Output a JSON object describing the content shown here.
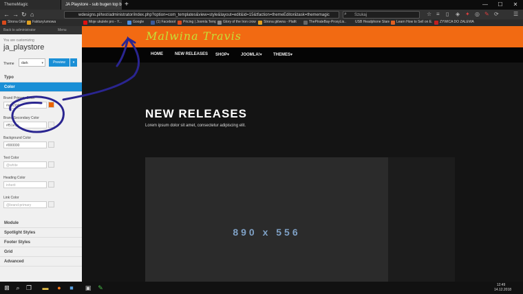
{
  "browser": {
    "tabs": [
      {
        "label": "ThemeMagic"
      },
      {
        "label": "JA Playstore - sub bugen top bar so..."
      }
    ],
    "new_tab": "+",
    "window_controls": {
      "minimize": "—",
      "maximize": "☐",
      "close": "✕"
    },
    "url": "wdesigns.pl/test/administrator/index.php?option=com_templates&view=style&layout=edit&id=15&tfaction=themeEditor&task=thememagic",
    "search_placeholder": "Szukaj",
    "bookmarks": [
      {
        "label": "Strona Główna: UPS",
        "color": "#d94a1c"
      },
      {
        "label": "Faktury/umowa online - ...",
        "color": "#e0a020"
      },
      {
        "label": "Moje ukulele pro - Y...",
        "color": "#e01010"
      },
      {
        "label": "Google",
        "color": "#4a8ee0"
      },
      {
        "label": "(1) Facebook",
        "color": "#3b5998"
      },
      {
        "label": "Pricing | Joomla Temp...",
        "color": "#d94a1c"
      },
      {
        "label": "Glory of the Iron crown ...",
        "color": "#888888"
      },
      {
        "label": "Strona główna - Platfo...",
        "color": "#e0a020"
      },
      {
        "label": "ThePirateBay-ProxyLis...",
        "color": "#666666"
      },
      {
        "label": "USB Headphone Stand...",
        "color": "#2a2a2a"
      },
      {
        "label": "Learn How to Sell on E...",
        "color": "#e06020"
      },
      {
        "label": "ŻYWICA DO ZALEWA...",
        "color": "#c02020"
      }
    ]
  },
  "left_panel": {
    "back_label": "Back to administrator",
    "mod_label": "Menu",
    "customizing_label": "You are customizing",
    "template_name": "ja_playstore",
    "theme_label": "Theme",
    "theme_value": "dark",
    "preview_button": "Preview",
    "sections": {
      "typo": "Typo",
      "color": "Color",
      "module": "Module",
      "spotlight": "Spotlight Styles",
      "footer": "Footer Styles",
      "grid": "Grid",
      "advanced": "Advanced"
    },
    "fields": [
      {
        "label": "Brand Primary Color",
        "value": "#eb6300",
        "swatch": "#eb6300",
        "placeholder": false
      },
      {
        "label": "Brand Secondary Color",
        "value": "#f51e1e",
        "swatch": "#eeeeee",
        "placeholder": false
      },
      {
        "label": "Background Color",
        "value": "#000000",
        "swatch": "#eeeeee",
        "placeholder": false
      },
      {
        "label": "Text Color",
        "value": "@white",
        "swatch": "#eeeeee",
        "placeholder": true
      },
      {
        "label": "Heading Color",
        "value": "inherit",
        "swatch": "#eeeeee",
        "placeholder": true
      },
      {
        "label": "Link Color",
        "value": "@brand-primary",
        "swatch": "#eeeeee",
        "placeholder": true
      }
    ]
  },
  "site": {
    "logo": "Malwina Travis",
    "menu": [
      "HOME",
      "NEW RELEASES",
      "SHOP",
      "JOOMLA!",
      "THEMES"
    ],
    "hero_title": "NEW RELEASES",
    "hero_subtitle": "Lorem ipsum dolor sit amet, consectetur adipiscing elit.",
    "placeholder_text": "890 x 556"
  },
  "taskbar": {
    "time": "12:49",
    "date": "14.12.2018",
    "apps": [
      "windows-icon",
      "search-icon",
      "task-view-icon",
      "file-explorer-icon",
      "firefox-icon",
      "app-icon",
      "terminal-icon",
      "notepad-icon"
    ]
  },
  "colors": {
    "header_orange": "#f26a12",
    "accent_blue": "#1a8fd6",
    "annotation_ink": "#2a2590"
  }
}
